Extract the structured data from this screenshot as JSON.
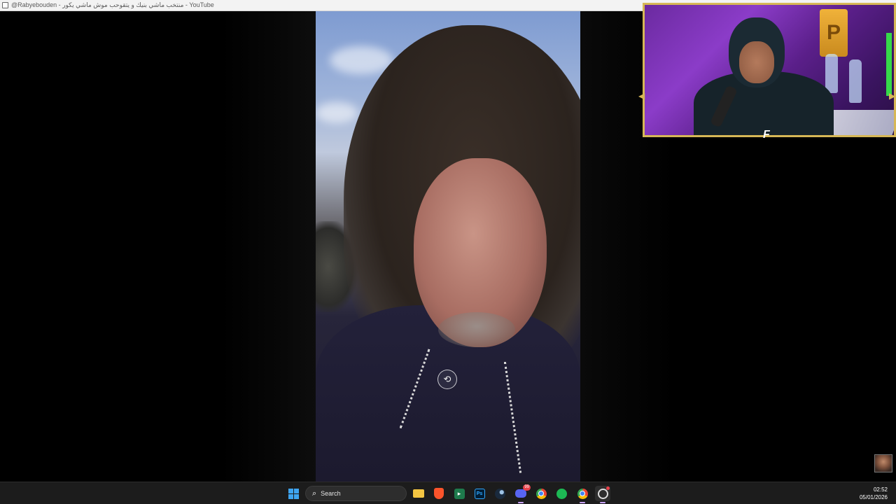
{
  "window": {
    "title": "@Rabyebouden - منتخب ماشي بنيك و يتقوحب موش ماشي يكور - YouTube"
  },
  "taskbar": {
    "search_label": "Search",
    "discord_badge": "99",
    "clock_time": "02:52",
    "clock_date": "05/01/2026",
    "apps": [
      "start",
      "search",
      "file-explorer",
      "brave",
      "app-store",
      "photoshop",
      "steam",
      "discord",
      "chrome",
      "spotify",
      "chrome-alt",
      "obs"
    ]
  },
  "colors": {
    "taskbar_bg": "#1c1c1c",
    "cam_border": "#d6b756",
    "windows_blue": "#3ea4f0",
    "spotify_green": "#1db954"
  },
  "icons": {
    "video_center": "screen-record-icon",
    "cam_overlay_logo": "ea-fc-logo"
  }
}
